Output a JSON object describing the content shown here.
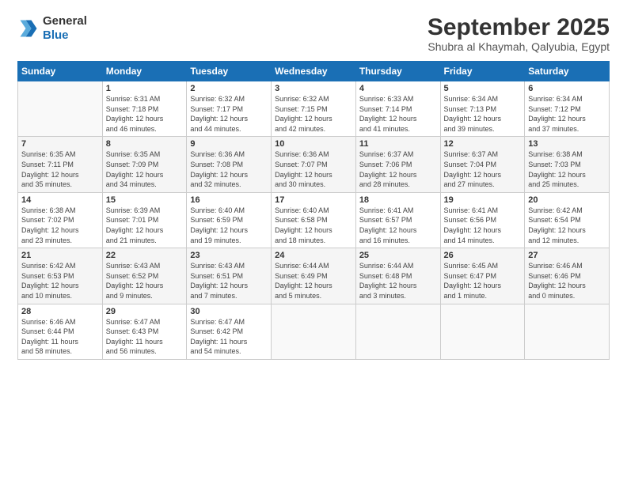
{
  "logo": {
    "line1": "General",
    "line2": "Blue"
  },
  "header": {
    "month": "September 2025",
    "location": "Shubra al Khaymah, Qalyubia, Egypt"
  },
  "weekdays": [
    "Sunday",
    "Monday",
    "Tuesday",
    "Wednesday",
    "Thursday",
    "Friday",
    "Saturday"
  ],
  "weeks": [
    [
      {
        "day": "",
        "info": ""
      },
      {
        "day": "1",
        "info": "Sunrise: 6:31 AM\nSunset: 7:18 PM\nDaylight: 12 hours\nand 46 minutes."
      },
      {
        "day": "2",
        "info": "Sunrise: 6:32 AM\nSunset: 7:17 PM\nDaylight: 12 hours\nand 44 minutes."
      },
      {
        "day": "3",
        "info": "Sunrise: 6:32 AM\nSunset: 7:15 PM\nDaylight: 12 hours\nand 42 minutes."
      },
      {
        "day": "4",
        "info": "Sunrise: 6:33 AM\nSunset: 7:14 PM\nDaylight: 12 hours\nand 41 minutes."
      },
      {
        "day": "5",
        "info": "Sunrise: 6:34 AM\nSunset: 7:13 PM\nDaylight: 12 hours\nand 39 minutes."
      },
      {
        "day": "6",
        "info": "Sunrise: 6:34 AM\nSunset: 7:12 PM\nDaylight: 12 hours\nand 37 minutes."
      }
    ],
    [
      {
        "day": "7",
        "info": "Sunrise: 6:35 AM\nSunset: 7:11 PM\nDaylight: 12 hours\nand 35 minutes."
      },
      {
        "day": "8",
        "info": "Sunrise: 6:35 AM\nSunset: 7:09 PM\nDaylight: 12 hours\nand 34 minutes."
      },
      {
        "day": "9",
        "info": "Sunrise: 6:36 AM\nSunset: 7:08 PM\nDaylight: 12 hours\nand 32 minutes."
      },
      {
        "day": "10",
        "info": "Sunrise: 6:36 AM\nSunset: 7:07 PM\nDaylight: 12 hours\nand 30 minutes."
      },
      {
        "day": "11",
        "info": "Sunrise: 6:37 AM\nSunset: 7:06 PM\nDaylight: 12 hours\nand 28 minutes."
      },
      {
        "day": "12",
        "info": "Sunrise: 6:37 AM\nSunset: 7:04 PM\nDaylight: 12 hours\nand 27 minutes."
      },
      {
        "day": "13",
        "info": "Sunrise: 6:38 AM\nSunset: 7:03 PM\nDaylight: 12 hours\nand 25 minutes."
      }
    ],
    [
      {
        "day": "14",
        "info": "Sunrise: 6:38 AM\nSunset: 7:02 PM\nDaylight: 12 hours\nand 23 minutes."
      },
      {
        "day": "15",
        "info": "Sunrise: 6:39 AM\nSunset: 7:01 PM\nDaylight: 12 hours\nand 21 minutes."
      },
      {
        "day": "16",
        "info": "Sunrise: 6:40 AM\nSunset: 6:59 PM\nDaylight: 12 hours\nand 19 minutes."
      },
      {
        "day": "17",
        "info": "Sunrise: 6:40 AM\nSunset: 6:58 PM\nDaylight: 12 hours\nand 18 minutes."
      },
      {
        "day": "18",
        "info": "Sunrise: 6:41 AM\nSunset: 6:57 PM\nDaylight: 12 hours\nand 16 minutes."
      },
      {
        "day": "19",
        "info": "Sunrise: 6:41 AM\nSunset: 6:56 PM\nDaylight: 12 hours\nand 14 minutes."
      },
      {
        "day": "20",
        "info": "Sunrise: 6:42 AM\nSunset: 6:54 PM\nDaylight: 12 hours\nand 12 minutes."
      }
    ],
    [
      {
        "day": "21",
        "info": "Sunrise: 6:42 AM\nSunset: 6:53 PM\nDaylight: 12 hours\nand 10 minutes."
      },
      {
        "day": "22",
        "info": "Sunrise: 6:43 AM\nSunset: 6:52 PM\nDaylight: 12 hours\nand 9 minutes."
      },
      {
        "day": "23",
        "info": "Sunrise: 6:43 AM\nSunset: 6:51 PM\nDaylight: 12 hours\nand 7 minutes."
      },
      {
        "day": "24",
        "info": "Sunrise: 6:44 AM\nSunset: 6:49 PM\nDaylight: 12 hours\nand 5 minutes."
      },
      {
        "day": "25",
        "info": "Sunrise: 6:44 AM\nSunset: 6:48 PM\nDaylight: 12 hours\nand 3 minutes."
      },
      {
        "day": "26",
        "info": "Sunrise: 6:45 AM\nSunset: 6:47 PM\nDaylight: 12 hours\nand 1 minute."
      },
      {
        "day": "27",
        "info": "Sunrise: 6:46 AM\nSunset: 6:46 PM\nDaylight: 12 hours\nand 0 minutes."
      }
    ],
    [
      {
        "day": "28",
        "info": "Sunrise: 6:46 AM\nSunset: 6:44 PM\nDaylight: 11 hours\nand 58 minutes."
      },
      {
        "day": "29",
        "info": "Sunrise: 6:47 AM\nSunset: 6:43 PM\nDaylight: 11 hours\nand 56 minutes."
      },
      {
        "day": "30",
        "info": "Sunrise: 6:47 AM\nSunset: 6:42 PM\nDaylight: 11 hours\nand 54 minutes."
      },
      {
        "day": "",
        "info": ""
      },
      {
        "day": "",
        "info": ""
      },
      {
        "day": "",
        "info": ""
      },
      {
        "day": "",
        "info": ""
      }
    ]
  ]
}
